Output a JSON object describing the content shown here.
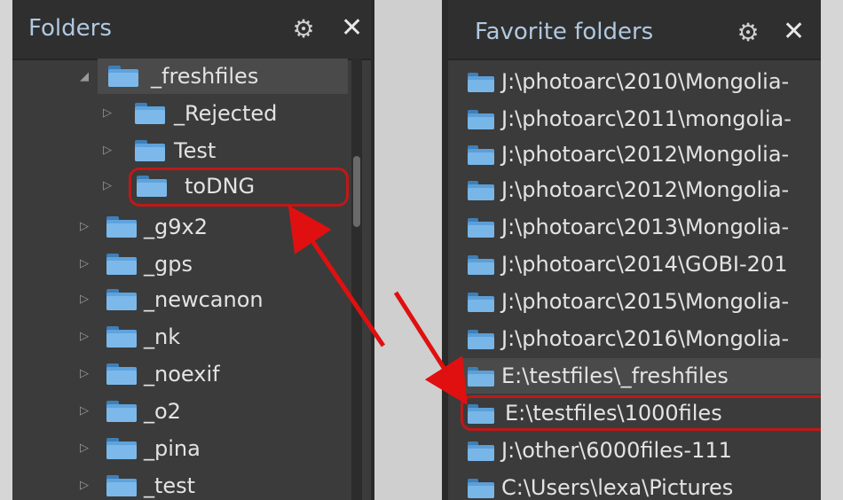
{
  "folders_panel": {
    "title": "Folders",
    "gear_icon": "gear-icon",
    "close_icon": "close-icon",
    "items": [
      {
        "label": "_freshfiles",
        "expander": "◢",
        "expanded": true
      },
      {
        "label": "_Rejected",
        "expander": "▷"
      },
      {
        "label": "Test",
        "expander": "▷"
      },
      {
        "label": "toDNG",
        "expander": "▷"
      },
      {
        "label": "_g9x2",
        "expander": "▷"
      },
      {
        "label": "_gps",
        "expander": "▷"
      },
      {
        "label": "_newcanon",
        "expander": "▷"
      },
      {
        "label": "_nk",
        "expander": "▷"
      },
      {
        "label": "_noexif",
        "expander": "▷"
      },
      {
        "label": "_o2",
        "expander": "▷"
      },
      {
        "label": "_pina",
        "expander": "▷"
      },
      {
        "label": "_test",
        "expander": "▷"
      }
    ]
  },
  "favorites_panel": {
    "title": "Favorite folders",
    "gear_icon": "gear-icon",
    "close_icon": "close-icon",
    "items": [
      {
        "label": "J:\\photoarc\\2010\\Mongolia-"
      },
      {
        "label": "J:\\photoarc\\2011\\mongolia-"
      },
      {
        "label": "J:\\photoarc\\2012\\Mongolia-"
      },
      {
        "label": "J:\\photoarc\\2012\\Mongolia-"
      },
      {
        "label": "J:\\photoarc\\2013\\Mongolia-"
      },
      {
        "label": "J:\\photoarc\\2014\\GOBI-201"
      },
      {
        "label": "J:\\photoarc\\2015\\Mongolia-"
      },
      {
        "label": "J:\\photoarc\\2016\\Mongolia-"
      },
      {
        "label": "E:\\testfiles\\_freshfiles"
      },
      {
        "label": "E:\\testfiles\\1000files"
      },
      {
        "label": "J:\\other\\6000files-111"
      },
      {
        "label": "C:\\Users\\lexa\\Pictures"
      }
    ]
  },
  "colors": {
    "highlight": "#c01818",
    "arrow": "#e01010",
    "folder_icon": "#5fa3dd"
  }
}
